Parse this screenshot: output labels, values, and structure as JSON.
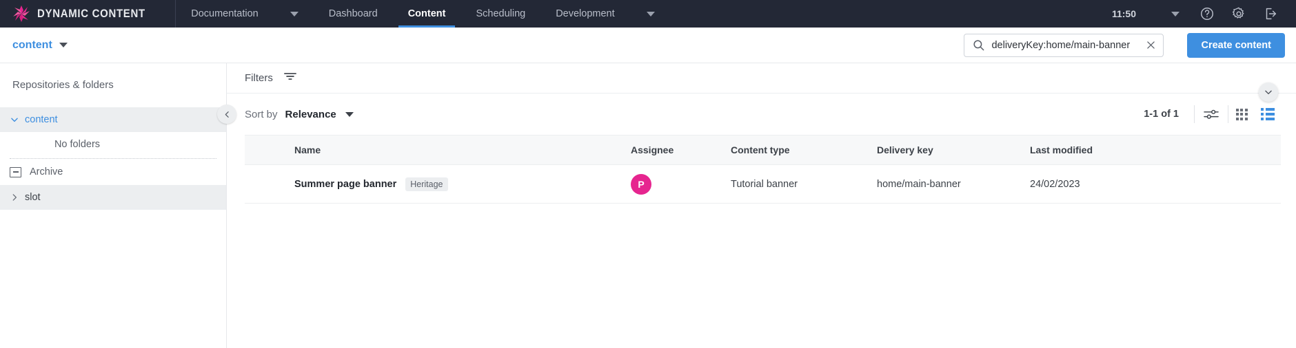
{
  "topnav": {
    "brand": "DYNAMIC CONTENT",
    "items": [
      {
        "label": "Documentation",
        "has_caret": true,
        "active": false
      },
      {
        "label": "Dashboard",
        "has_caret": false,
        "active": false
      },
      {
        "label": "Content",
        "has_caret": false,
        "active": true
      },
      {
        "label": "Scheduling",
        "has_caret": false,
        "active": false
      },
      {
        "label": "Development",
        "has_caret": true,
        "active": false
      }
    ],
    "clock": "11:50",
    "icons": [
      "user-caret-icon",
      "help-icon",
      "gear-icon",
      "logout-icon"
    ]
  },
  "subbar": {
    "repository": "content",
    "search": {
      "value": "deliveryKey:home/main-banner",
      "placeholder": "Search"
    },
    "create_button": "Create content"
  },
  "sidebar": {
    "title": "Repositories & folders",
    "tree": [
      {
        "label": "content",
        "expanded": true,
        "selected": true,
        "link": true
      },
      {
        "label": "slot",
        "expanded": false,
        "selected": true,
        "link": false
      }
    ],
    "empty_text": "No folders",
    "archive": "Archive"
  },
  "toolbar": {
    "filters_label": "Filters",
    "sort_by_label": "Sort by",
    "sort_value": "Relevance",
    "count": "1-1 of 1",
    "icons": [
      "settings-sliders-icon",
      "grid-view-icon",
      "list-view-icon"
    ],
    "active_view": "list"
  },
  "table": {
    "columns": [
      "Name",
      "Assignee",
      "Content type",
      "Delivery key",
      "Last modified"
    ],
    "rows": [
      {
        "name": "Summer page banner",
        "badge": "Heritage",
        "assignee_initial": "P",
        "assignee_color": "#e6258f",
        "content_type": "Tutorial banner",
        "delivery_key": "home/main-banner",
        "last_modified": "24/02/2023"
      }
    ]
  },
  "colors": {
    "topbar_bg": "#232836",
    "accent": "#3e8fe0",
    "selected_row": "#eceef0",
    "header_bg": "#f7f8f9"
  }
}
